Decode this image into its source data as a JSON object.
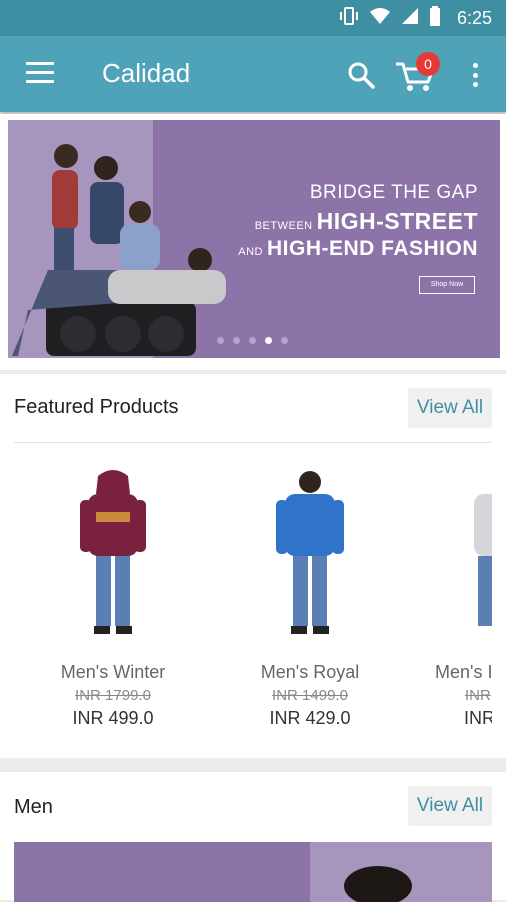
{
  "status_bar": {
    "time": "6:25",
    "icons": [
      "vibrate-icon",
      "wifi-icon",
      "signal-icon",
      "battery-icon"
    ]
  },
  "app_bar": {
    "title": "Calidad",
    "cart_count": "0",
    "icons": [
      "menu-icon",
      "search-icon",
      "cart-icon",
      "more-vert-icon"
    ]
  },
  "banner": {
    "line1": "BRIDGE THE GAP",
    "line2_small": "BETWEEN",
    "line2_big": "HIGH-STREET",
    "line3_small": "AND",
    "line3_big": "HIGH-END FASHION",
    "cta": "Shop Now",
    "slide_count": 5,
    "active_slide": 4
  },
  "featured": {
    "title": "Featured Products",
    "view_all": "View All",
    "products": [
      {
        "name": "Men's Winter",
        "old_price": "INR 1799.0",
        "price": "INR 499.0",
        "color": "#7b2140"
      },
      {
        "name": "Men's Royal",
        "old_price": "INR 1499.0",
        "price": "INR 429.0",
        "color": "#2f74c8"
      },
      {
        "name": "Men's I",
        "old_price": "INR",
        "price": "INR",
        "color": "#d4d6da"
      }
    ]
  },
  "men": {
    "title": "Men",
    "view_all": "View All"
  },
  "colors": {
    "status_bar": "#3f8fa3",
    "app_bar": "#4fa3b8",
    "accent": "#3f8fa3",
    "badge": "#e53935",
    "banner": "#8c74a9"
  }
}
